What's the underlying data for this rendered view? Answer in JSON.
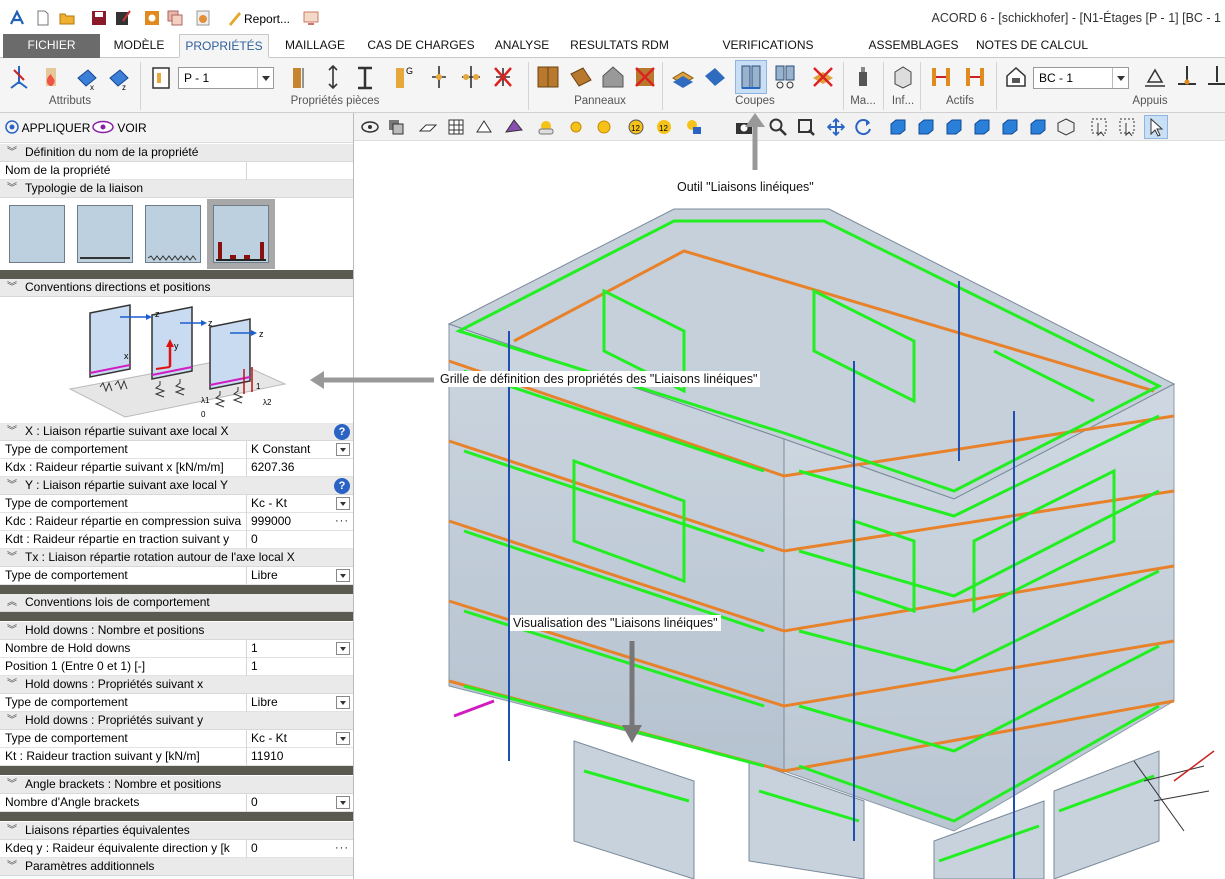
{
  "window": {
    "title": "ACORD 6 - [schickhofer] - [N1-Étages [P - 1] [BC - 1"
  },
  "quick_access": {
    "report_label": "Report..."
  },
  "tabs": [
    {
      "label": "FICHIER"
    },
    {
      "label": "MODÈLE"
    },
    {
      "label": "PROPRIÉTÉS",
      "active": true
    },
    {
      "label": "MAILLAGE"
    },
    {
      "label": "CAS DE CHARGES"
    },
    {
      "label": "ANALYSE"
    },
    {
      "label": "RESULTATS RDM"
    },
    {
      "label": "VERIFICATIONS EUROCODES"
    },
    {
      "label": "ASSEMBLAGES"
    },
    {
      "label": "NOTES DE CALCUL"
    }
  ],
  "ribbon": {
    "groups": [
      {
        "label": "Attributs"
      },
      {
        "label": "Propriétés pièces"
      },
      {
        "label": "Panneaux"
      },
      {
        "label": "Coupes"
      },
      {
        "label": "Ma..."
      },
      {
        "label": "Inf..."
      },
      {
        "label": "Actifs"
      },
      {
        "label": "Appuis"
      }
    ],
    "piece_combo_value": "P - 1",
    "bc_combo_value": "BC - 1"
  },
  "panel": {
    "apply_label": "APPLIQUER",
    "view_label": "VOIR",
    "sections": {
      "name_def": "Définition du nom de la propriété",
      "typology": "Typologie de la liaison",
      "conventions": "Conventions directions et positions",
      "x_liaison": "X : Liaison répartie suivant axe local X",
      "y_liaison": "Y : Liaison répartie suivant axe local Y",
      "tx_liaison": "Tx : Liaison répartie rotation autour de l'axe local X",
      "conv_lois": "Conventions lois de comportement",
      "hd_count": "Hold downs : Nombre et positions",
      "hd_x": "Hold downs : Propriétés suivant x",
      "hd_y": "Hold downs : Propriétés suivant y",
      "ab_count": "Angle brackets : Nombre et positions",
      "equiv": "Liaisons réparties équivalentes",
      "params": "Paramètres additionnels"
    },
    "rows": {
      "name": {
        "key": "Nom de la propriété",
        "value": ""
      },
      "x_type": {
        "key": "Type de comportement",
        "value": "K Constant"
      },
      "kdx": {
        "key": "Kdx : Raideur répartie suivant x  [kN/m/m]",
        "value": "6207.36"
      },
      "y_type": {
        "key": "Type de comportement",
        "value": "Kc - Kt"
      },
      "kdc": {
        "key": "Kdc : Raideur répartie en compression suiva",
        "value": "999000"
      },
      "kdt": {
        "key": "Kdt : Raideur répartie en traction suivant y",
        "value": "0"
      },
      "tx_type": {
        "key": "Type de comportement",
        "value": "Libre"
      },
      "hd_n": {
        "key": "Nombre de Hold downs",
        "value": "1"
      },
      "hd_pos": {
        "key": "Position 1 (Entre 0 et 1)  [-]",
        "value": "1"
      },
      "hdx_type": {
        "key": "Type de comportement",
        "value": "Libre"
      },
      "hdy_type": {
        "key": "Type de comportement",
        "value": "Kc - Kt"
      },
      "kt": {
        "key": "Kt : Raideur traction suivant y  [kN/m]",
        "value": "11910"
      },
      "ab_n": {
        "key": "Nombre d'Angle brackets",
        "value": "0"
      },
      "kdeq": {
        "key": "Kdeq y : Raideur équivalente direction y  [k",
        "value": "0"
      }
    },
    "diagram_labels": {
      "z1": "z",
      "z2": "z",
      "z3": "z",
      "x": "x",
      "y": "y",
      "one": "1",
      "zero": "0",
      "l1": "λ1",
      "l2": "λ2"
    }
  },
  "annotations": {
    "tool": "Outil \"Liaisons linéiques\"",
    "grid": "Grille de définition des propriétés des \"Liaisons linéiques\"",
    "visual": "Visualisation des \"Liaisons linéiques\""
  },
  "colors": {
    "accent_blue": "#2f5f9a",
    "liaison_green": "#22ee22",
    "beam_orange": "#e8822a",
    "column_blue": "#1f4fb0",
    "panel_fill": "#b9c6d4"
  },
  "icons": [
    "acord-logo-icon",
    "new-file-icon",
    "open-folder-icon",
    "save-icon",
    "save-as-icon",
    "settings-icon",
    "copy-icon",
    "export-icon",
    "report-icon",
    "screen-icon",
    "camera-icon",
    "zoom-icon",
    "pan-icon",
    "rotate-icon",
    "sun-icon",
    "help-icon",
    "eye-icon",
    "cursor-icon"
  ]
}
